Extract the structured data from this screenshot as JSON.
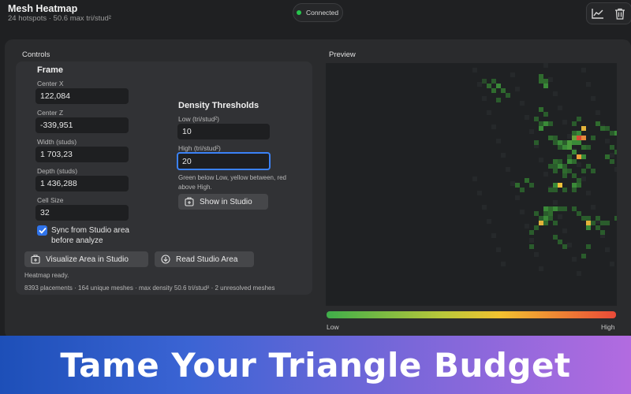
{
  "header": {
    "title": "Mesh Heatmap",
    "subtitle": "24 hotspots · 50.6 max tri/stud²",
    "status": "Connected",
    "status_color": "#27c54d",
    "toolbar_icons": [
      "chart-icon",
      "trash-icon"
    ]
  },
  "controls": {
    "section_title": "Controls",
    "frame": {
      "title": "Frame",
      "fields": [
        {
          "label": "Center X",
          "value": "122,084"
        },
        {
          "label": "Center Z",
          "value": "-339,951"
        },
        {
          "label": "Width (studs)",
          "value": "1 703,23"
        },
        {
          "label": "Depth (studs)",
          "value": "1 436,288"
        },
        {
          "label": "Cell Size",
          "value": "32"
        }
      ],
      "sync_checkbox": {
        "label": "Sync from Studio area before analyze",
        "checked": true
      }
    },
    "density": {
      "title": "Density Thresholds",
      "low_label": "Low (tri/stud²)",
      "low_value": "10",
      "high_label": "High (tri/stud²)",
      "high_value": "20",
      "help": "Green below Low, yellow between, red above High.",
      "show_button": "Show in Studio"
    },
    "visualize_button": "Visualize Area in Studio",
    "read_button": "Read Studio Area",
    "status": "Heatmap ready.",
    "stats": "8393 placements · 164 unique meshes · max density 50.6 tri/stud² · 2 unresolved meshes"
  },
  "preview": {
    "title": "Preview",
    "legend_low": "Low",
    "legend_high": "High",
    "colors": {
      "green": "#3fae4a",
      "yellow": "#f2c130",
      "red": "#ea4a38"
    }
  },
  "banner": {
    "text": "Tame Your Triangle Budget"
  }
}
